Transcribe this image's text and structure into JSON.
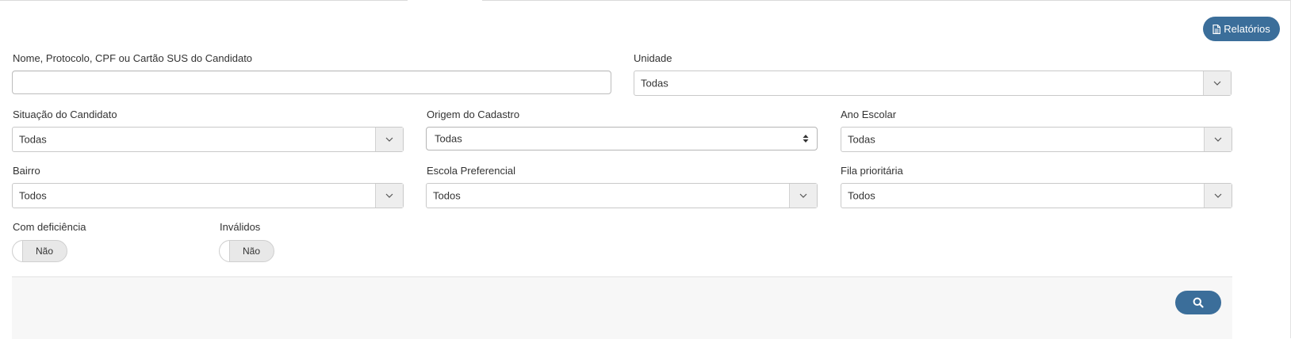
{
  "header": {
    "reports_button_label": "Relatórios"
  },
  "filters": {
    "name_field": {
      "label": "Nome, Protocolo, CPF ou Cartão SUS do Candidato",
      "value": "",
      "placeholder": ""
    },
    "unidade": {
      "label": "Unidade",
      "value": "Todas"
    },
    "situacao": {
      "label": "Situação do Candidato",
      "value": "Todas"
    },
    "origem": {
      "label": "Origem do Cadastro",
      "value": "Todas"
    },
    "ano_escolar": {
      "label": "Ano Escolar",
      "value": "Todas"
    },
    "bairro": {
      "label": "Bairro",
      "value": "Todos"
    },
    "escola_preferencial": {
      "label": "Escola Preferencial",
      "value": "Todos"
    },
    "fila_prioritaria": {
      "label": "Fila prioritária",
      "value": "Todos"
    },
    "com_deficiencia": {
      "label": "Com deficiência",
      "value": "Não"
    },
    "invalidos": {
      "label": "Inválidos",
      "value": "Não"
    }
  },
  "icons": {
    "reports": "file-text-icon",
    "dropdown": "chevron-down-icon",
    "native_select": "sort-updown-icon",
    "search": "search-icon"
  },
  "colors": {
    "primary_button": "#3b6e9a",
    "footer_background": "#f7f7f7"
  }
}
